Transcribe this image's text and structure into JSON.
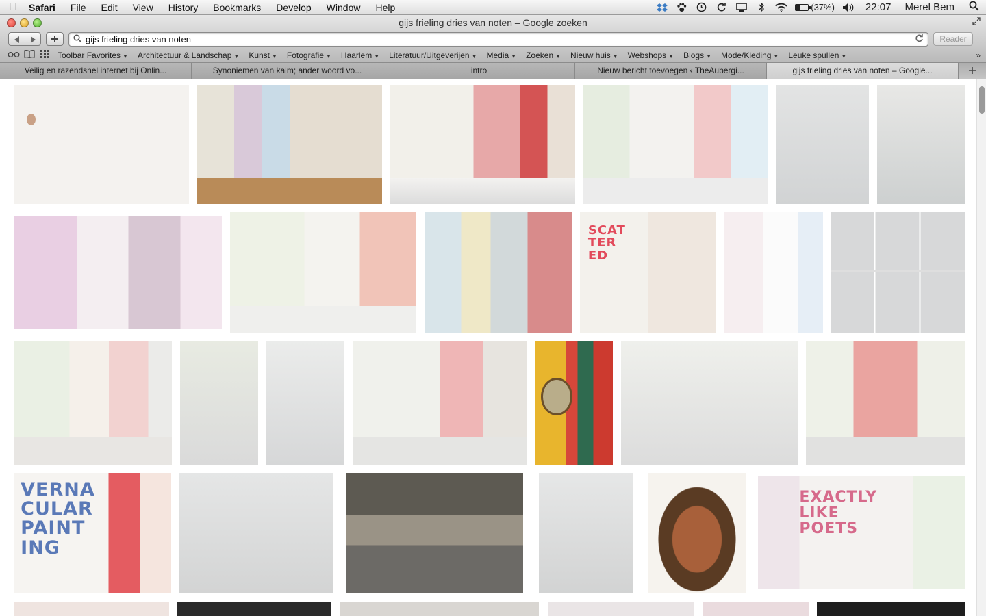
{
  "menubar": {
    "app_name": "Safari",
    "menus": [
      "File",
      "Edit",
      "View",
      "History",
      "Bookmarks",
      "Develop",
      "Window",
      "Help"
    ],
    "battery_percent": "(37%)",
    "battery_level": 0.37,
    "clock": "22:07",
    "user": "Merel Bem"
  },
  "window": {
    "title": "gijs frieling dries van noten – Google zoeken"
  },
  "toolbar": {
    "address": "gijs frieling dries van noten",
    "reader_label": "Reader"
  },
  "bookmarks": {
    "items": [
      {
        "label": "Toolbar Favorites",
        "dropdown": true
      },
      {
        "label": "Architectuur & Landschap",
        "dropdown": true
      },
      {
        "label": "Kunst",
        "dropdown": true
      },
      {
        "label": "Fotografie",
        "dropdown": true
      },
      {
        "label": "Haarlem",
        "dropdown": true
      },
      {
        "label": "Literatuur/Uitgeverijen",
        "dropdown": true
      },
      {
        "label": "Media",
        "dropdown": true
      },
      {
        "label": "Zoeken",
        "dropdown": true
      },
      {
        "label": "Nieuw huis",
        "dropdown": true
      },
      {
        "label": "Webshops",
        "dropdown": true
      },
      {
        "label": "Blogs",
        "dropdown": true
      },
      {
        "label": "Mode/Kleding",
        "dropdown": true
      },
      {
        "label": "Leuke spullen",
        "dropdown": true
      }
    ]
  },
  "tabs": [
    {
      "label": "Veilig en razendsnel internet bij Onlin...",
      "active": false
    },
    {
      "label": "Synoniemen van kalm; ander woord vo...",
      "active": false
    },
    {
      "label": "intro",
      "active": false
    },
    {
      "label": "Nieuw bericht toevoegen ‹ TheAubergi...",
      "active": false
    },
    {
      "label": "gijs frieling dries van noten – Google...",
      "active": true
    }
  ],
  "image_text": {
    "scatter": "SCAT TER ED",
    "vernacular": "VERNA CULAR PAINT ING",
    "exactly": "EXACTLY LIKE POETS"
  }
}
